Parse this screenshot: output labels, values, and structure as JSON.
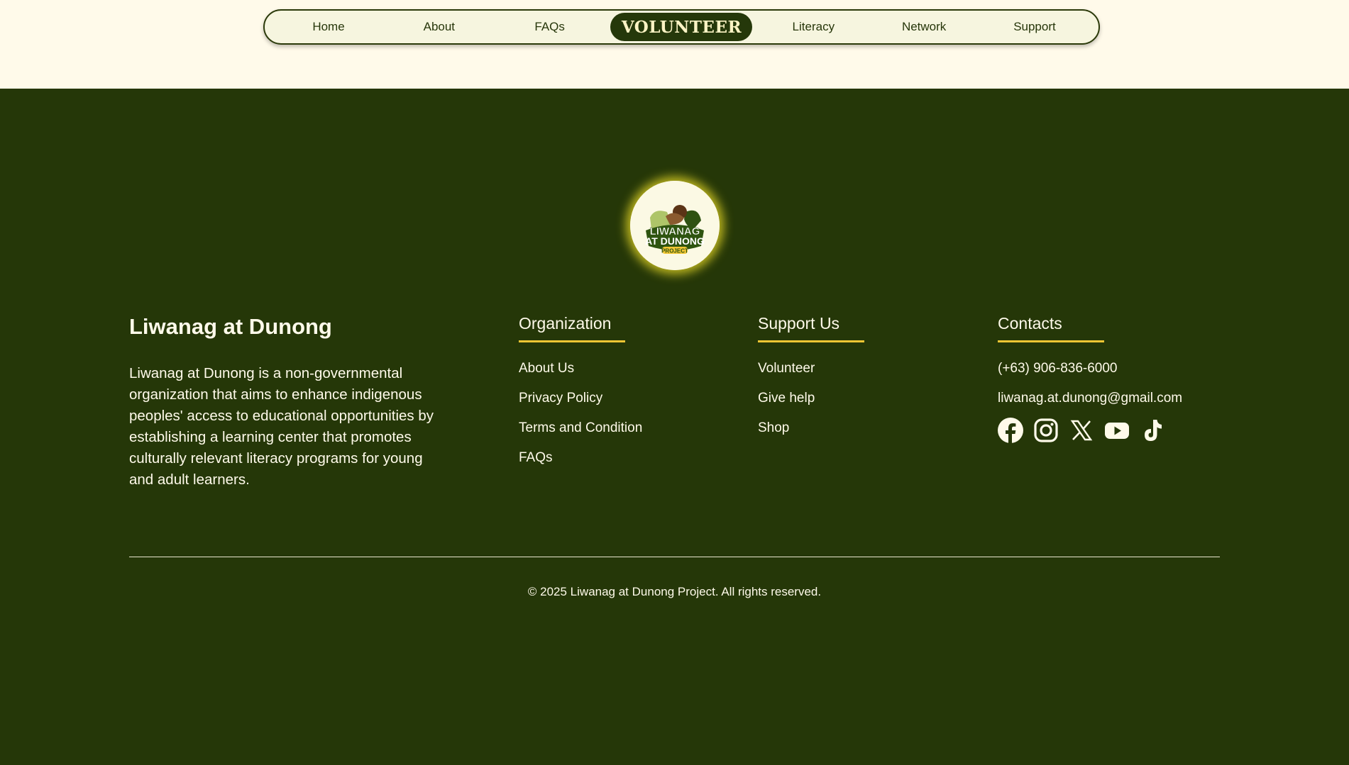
{
  "nav": {
    "items": [
      {
        "label": "Home"
      },
      {
        "label": "About"
      },
      {
        "label": "FAQs"
      },
      {
        "label": "VOLUNTEER"
      },
      {
        "label": "Literacy"
      },
      {
        "label": "Network"
      },
      {
        "label": "Support"
      }
    ]
  },
  "logo": {
    "line1": "LIWANAG",
    "line2": "AT DUNONG",
    "line3": "PROJECT"
  },
  "footer": {
    "brand_title": "Liwanag at Dunong",
    "brand_description": "Liwanag at Dunong is a non-governmental organization that aims to enhance indigenous peoples' access to educational opportunities by establishing a learning center that promotes culturally relevant literacy programs for young and adult learners.",
    "organization": {
      "heading": "Organization",
      "links": [
        "About Us",
        "Privacy Policy",
        "Terms and Condition",
        "FAQs"
      ]
    },
    "support": {
      "heading": "Support Us",
      "links": [
        "Volunteer",
        "Give help",
        "Shop"
      ]
    },
    "contacts": {
      "heading": "Contacts",
      "phone": "(+63) 906-836-6000",
      "email": "liwanag.at.dunong@gmail.com",
      "social_icons": [
        "facebook-icon",
        "instagram-icon",
        "x-icon",
        "youtube-icon",
        "tiktok-icon"
      ]
    },
    "copyright": "© 2025 Liwanag at Dunong Project. All rights reserved."
  },
  "colors": {
    "background_light": "#fffaea",
    "footer_green": "#253708",
    "accent_yellow": "#f2c634"
  }
}
